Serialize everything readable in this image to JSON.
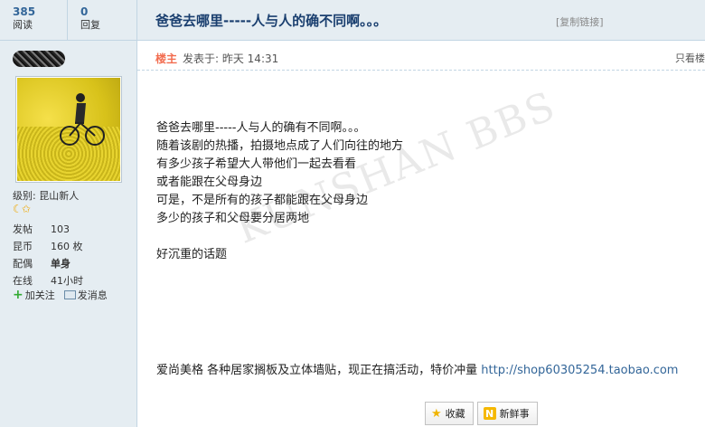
{
  "stats": {
    "views": {
      "num": "385",
      "label": "阅读"
    },
    "replies": {
      "num": "0",
      "label": "回复"
    }
  },
  "title": {
    "text": "爸爸去哪里-----人与人的确不同啊。。。",
    "copy": "[复制链接]"
  },
  "user": {
    "level_prefix": "级别:",
    "level_name": "昆山新人",
    "stars": "☾✩",
    "info": [
      {
        "key": "发帖",
        "value": "103",
        "bold": false
      },
      {
        "key": "昆币",
        "value": "160 枚",
        "bold": false
      },
      {
        "key": "配偶",
        "value": "单身",
        "bold": true
      },
      {
        "key": "在线",
        "value": "41小时",
        "bold": false
      }
    ],
    "follow": "加关注",
    "message": "发消息"
  },
  "post": {
    "author_tag": "楼主",
    "posted": "发表于: 昨天 14:31",
    "only_view": "只看楼",
    "lines": [
      "爸爸去哪里-----人与人的确有不同啊。。。",
      "随着该剧的热播，拍摄地点成了人们向往的地方",
      "有多少孩子希望大人带他们一起去看看",
      "或者能跟在父母身边",
      "可是，不是所有的孩子都能跟在父母身边",
      "多少的孩子和父母要分居两地"
    ],
    "closing": "好沉重的话题",
    "watermark": "KUNSHAN BBS",
    "ad_text": "爱尚美格 各种居家搁板及立体墙贴，现正在搞活动，特价冲量 ",
    "ad_link": "http://shop60305254.taobao.com"
  },
  "buttons": {
    "favorite": "收藏",
    "fresh": "新鲜事"
  }
}
